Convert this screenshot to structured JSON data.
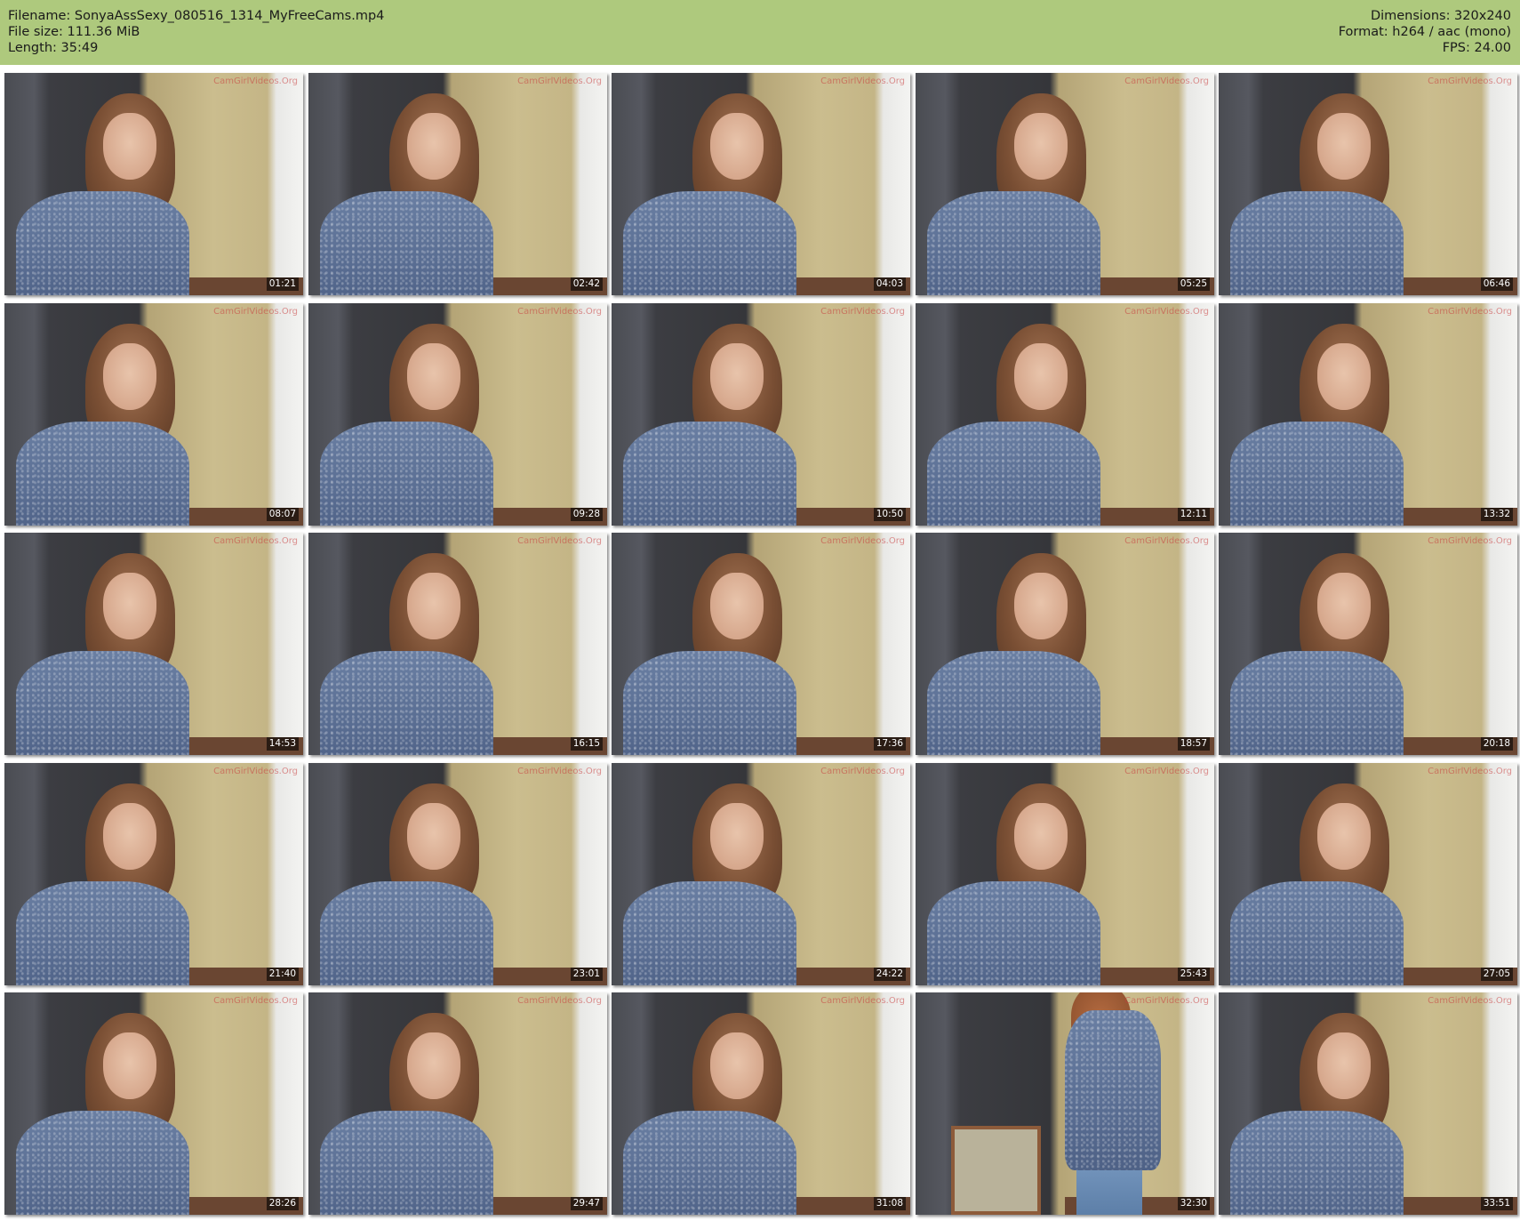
{
  "header": {
    "filename_line": "Filename: SonyaAssSexy_080516_1314_MyFreeCams.mp4",
    "filesize_line": "File size: 111.36 MiB",
    "length_line": "Length: 35:49",
    "dimensions_line": "Dimensions: 320x240",
    "format_line": "Format: h264 / aac (mono)",
    "fps_line": "FPS: 24.00"
  },
  "watermark": "CamGirlVideos.Org",
  "thumbnails": [
    {
      "time": "01:21"
    },
    {
      "time": "02:42"
    },
    {
      "time": "04:03"
    },
    {
      "time": "05:25"
    },
    {
      "time": "06:46"
    },
    {
      "time": "08:07"
    },
    {
      "time": "09:28"
    },
    {
      "time": "10:50"
    },
    {
      "time": "12:11"
    },
    {
      "time": "13:32"
    },
    {
      "time": "14:53"
    },
    {
      "time": "16:15"
    },
    {
      "time": "17:36"
    },
    {
      "time": "18:57"
    },
    {
      "time": "20:18"
    },
    {
      "time": "21:40"
    },
    {
      "time": "23:01"
    },
    {
      "time": "24:22"
    },
    {
      "time": "25:43"
    },
    {
      "time": "27:05"
    },
    {
      "time": "28:26"
    },
    {
      "time": "29:47"
    },
    {
      "time": "31:08"
    },
    {
      "time": "32:30"
    },
    {
      "time": "33:51"
    }
  ],
  "colors": {
    "header_bg": "#aec97d",
    "timestamp_bg": "#000000"
  }
}
